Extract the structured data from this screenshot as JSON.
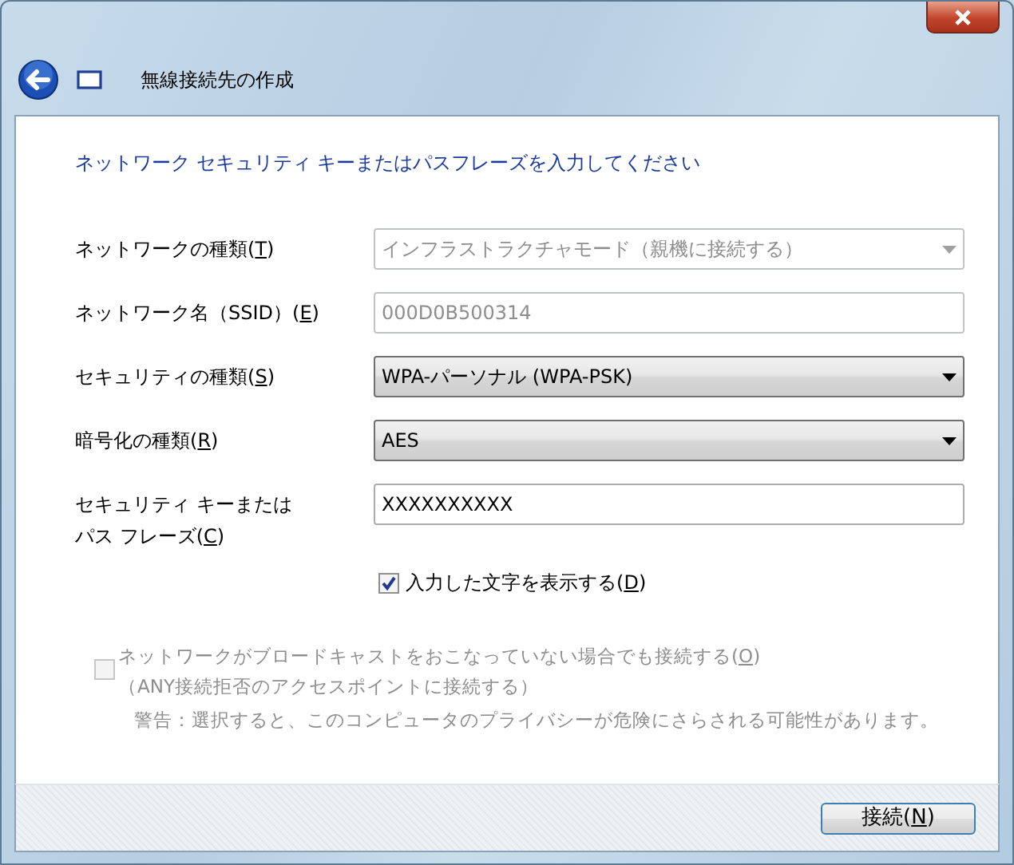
{
  "window": {
    "title": "無線接続先の作成"
  },
  "heading": "ネットワーク セキュリティ キーまたはパスフレーズを入力してください",
  "fields": [
    {
      "kind": "select",
      "label": {
        "before": "ネットワークの種類(",
        "key": "T",
        "after": ")"
      },
      "value": "インフラストラクチャモード（親機に接続する）",
      "disabled": true
    },
    {
      "kind": "text",
      "label": {
        "before": "ネットワーク名（SSID）(",
        "key": "E",
        "after": ")"
      },
      "value": "000D0B500314",
      "disabled": true
    },
    {
      "kind": "select",
      "label": {
        "before": "セキュリティの種類(",
        "key": "S",
        "after": ")"
      },
      "value": "WPA-パーソナル (WPA-PSK)",
      "disabled": false
    },
    {
      "kind": "select",
      "label": {
        "before": "暗号化の種類(",
        "key": "R",
        "after": ")"
      },
      "value": "AES",
      "disabled": false
    },
    {
      "kind": "text",
      "label": {
        "first_line": "セキュリティ キーまたは",
        "before": "パス フレーズ(",
        "key": "C",
        "after": ")"
      },
      "value": "XXXXXXXXXX",
      "disabled": false
    }
  ],
  "show_characters": {
    "label": {
      "before": "入力した文字を表示する(",
      "key": "D",
      "after": ")"
    },
    "checked": true,
    "disabled": false
  },
  "broadcast_option": {
    "label": {
      "before": "ネットワークがブロードキャストをおこなっていない場合でも接続する(",
      "key": "O",
      "after": ")"
    },
    "note": "（ANY接続拒否のアクセスポイントに接続する）",
    "warning": "警告：選択すると、このコンピュータのプライバシーが危険にさらされる可能性があります。",
    "checked": false,
    "disabled": true
  },
  "connect_button": {
    "before": "接続(",
    "key": "N",
    "after": ")"
  }
}
